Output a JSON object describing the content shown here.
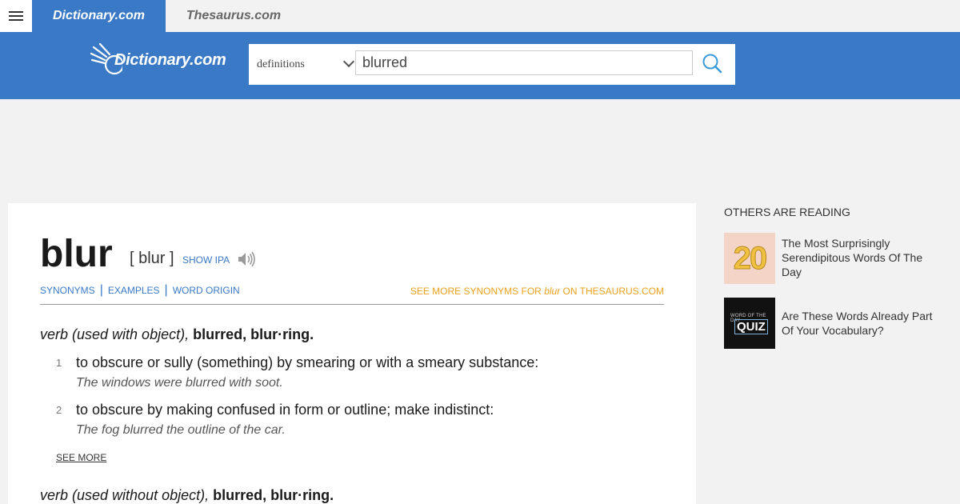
{
  "tabs": {
    "dictionary": "Dictionary.com",
    "thesaurus": "Thesaurus.com"
  },
  "header": {
    "logo_text": "Dictionary.com",
    "search_type": "definitions",
    "search_value": "blurred",
    "icons": {
      "menu": "hamburger-icon",
      "search": "magnifier-icon",
      "dropdown": "chevron-down-icon"
    }
  },
  "entry": {
    "headword": "blur",
    "pronunciation": "[ blur ]",
    "show_ipa": "SHOW IPA",
    "subnav": [
      "SYNONYMS",
      "EXAMPLES",
      "WORD ORIGIN"
    ],
    "more_synonyms_prefix": "SEE MORE SYNONYMS FOR ",
    "more_synonyms_word": "blur",
    "more_synonyms_suffix": " ON THESAURUS.COM",
    "sections": [
      {
        "pos": "verb (used with object),",
        "forms": "blurred, blur·ring.",
        "definitions": [
          {
            "num": "1",
            "text": "to obscure or sully (something) by smearing or with a smeary substance:",
            "example": "The windows were blurred with soot."
          },
          {
            "num": "2",
            "text": "to obscure by making confused in form or outline; make indistinct:",
            "example": "The fog blurred the outline of the car."
          }
        ],
        "see_more": "SEE MORE"
      },
      {
        "pos": "verb (used without object),",
        "forms": "blurred, blur·ring."
      }
    ]
  },
  "sidebar": {
    "title": "OTHERS ARE READING",
    "items": [
      {
        "thumb_text": "20",
        "title": "The Most Surprisingly Serendipitous Words Of The Day"
      },
      {
        "thumb_caption": "WORD OF THE DAY",
        "thumb_text": "QUIZ",
        "title": "Are These Words Already Part Of Your Vocabulary?"
      }
    ]
  },
  "colors": {
    "brand_blue": "#3a79c6",
    "link_orange": "#e8a11c",
    "background": "#f2f2f2"
  }
}
